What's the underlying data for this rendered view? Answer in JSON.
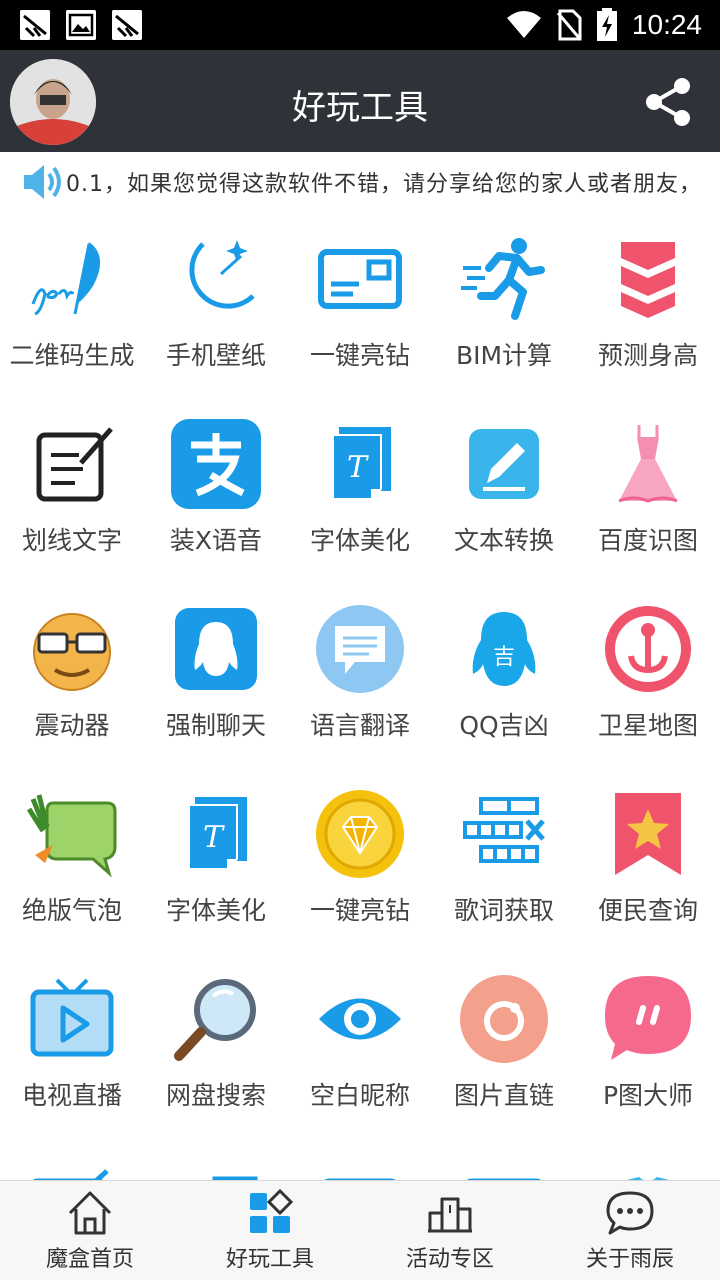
{
  "status_bar": {
    "time": "10:24"
  },
  "header": {
    "title": "好玩工具"
  },
  "marquee": {
    "text": "0.1，如果您觉得这款软件不错，请分享给您的家人或者朋友，"
  },
  "tools": [
    {
      "label": "二维码生成",
      "icon": "feather-pen-icon"
    },
    {
      "label": "手机壁纸",
      "icon": "moon-stars-icon"
    },
    {
      "label": "一键亮钻",
      "icon": "card-icon"
    },
    {
      "label": "BIM计算",
      "icon": "runner-icon"
    },
    {
      "label": "预测身高",
      "icon": "chevrons-icon"
    },
    {
      "label": "划线文字",
      "icon": "note-edit-icon"
    },
    {
      "label": "装X语音",
      "icon": "alipay-icon"
    },
    {
      "label": "字体美化",
      "icon": "font-doc-icon"
    },
    {
      "label": "文本转换",
      "icon": "pencil-box-icon"
    },
    {
      "label": "百度识图",
      "icon": "dress-icon"
    },
    {
      "label": "震动器",
      "icon": "glasses-face-icon"
    },
    {
      "label": "强制聊天",
      "icon": "penguin-icon"
    },
    {
      "label": "语言翻译",
      "icon": "speech-bubble-icon"
    },
    {
      "label": "QQ吉凶",
      "icon": "penguin-luck-icon"
    },
    {
      "label": "卫星地图",
      "icon": "anchor-icon"
    },
    {
      "label": "绝版气泡",
      "icon": "vegetable-bubble-icon"
    },
    {
      "label": "字体美化",
      "icon": "font-doc-icon"
    },
    {
      "label": "一键亮钻",
      "icon": "diamond-coin-icon"
    },
    {
      "label": "歌词获取",
      "icon": "bricks-icon"
    },
    {
      "label": "便民查询",
      "icon": "star-bookmark-icon"
    },
    {
      "label": "电视直播",
      "icon": "tv-play-icon"
    },
    {
      "label": "网盘搜索",
      "icon": "magnifier-icon"
    },
    {
      "label": "空白昵称",
      "icon": "eye-icon"
    },
    {
      "label": "图片直链",
      "icon": "link-circle-icon"
    },
    {
      "label": "P图大师",
      "icon": "chat-bubble-icon"
    }
  ],
  "bottom_nav": [
    {
      "label": "魔盒首页",
      "icon": "home-icon"
    },
    {
      "label": "好玩工具",
      "icon": "apps-icon"
    },
    {
      "label": "活动专区",
      "icon": "podium-icon"
    },
    {
      "label": "关于雨辰",
      "icon": "message-icon"
    }
  ]
}
